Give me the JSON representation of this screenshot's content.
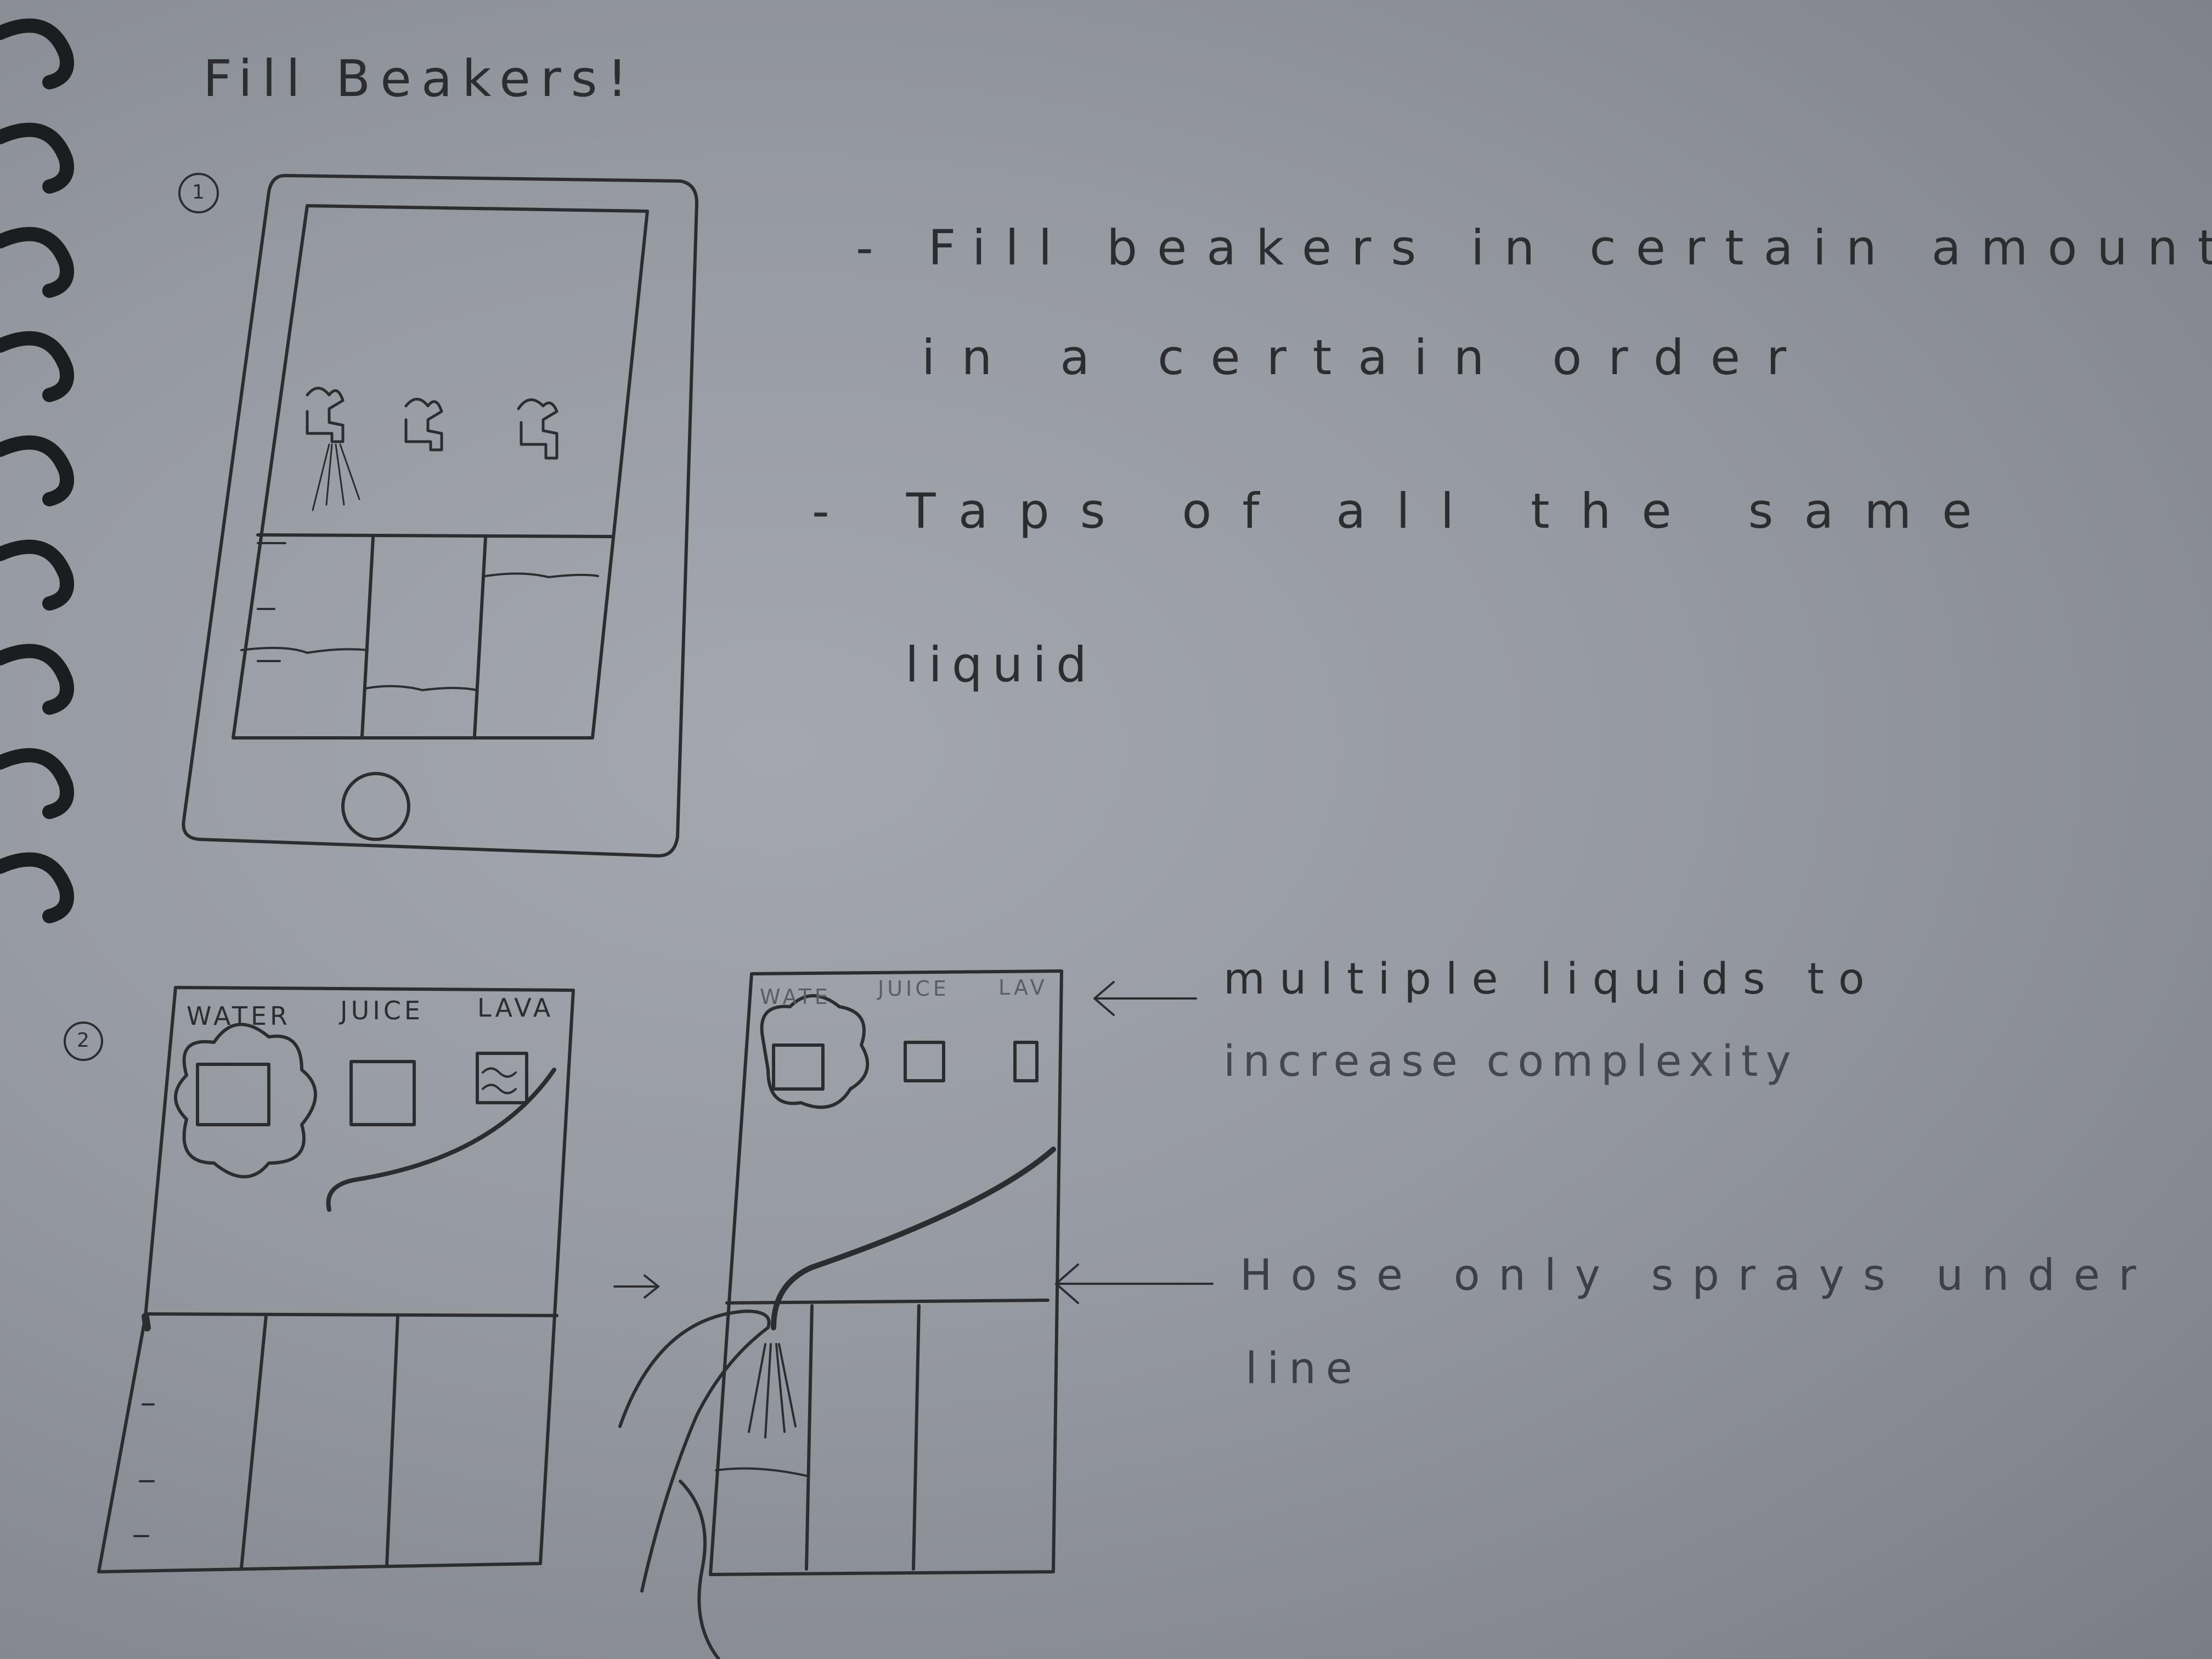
{
  "page_title": "Fill Beakers!",
  "sketch1": {
    "number": "1",
    "notes": [
      "- Fill beakers in certain amounts",
      "in a certain order",
      "- Taps of all the same",
      "liquid"
    ]
  },
  "sketch2": {
    "number": "2",
    "tabs": [
      "WATER",
      "JUICE",
      "LAVA"
    ],
    "tabs_small": [
      "WATE",
      "JUICE",
      "LAV"
    ],
    "arrow_between": "→",
    "note_liquids": [
      "multiple liquids to",
      "increase complexity"
    ],
    "note_hose": [
      "Hose only sprays under",
      "line"
    ]
  },
  "colors": {
    "paper": "#9a9fa5",
    "pencil": "#2b2d31",
    "spiral": "#1c1d20"
  }
}
